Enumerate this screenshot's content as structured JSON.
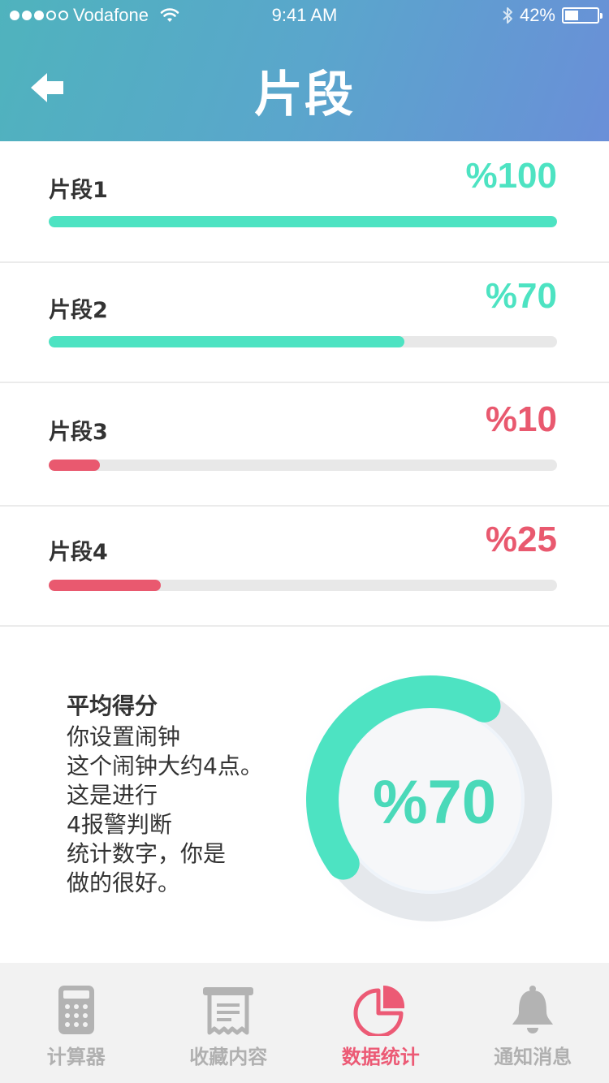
{
  "status_bar": {
    "carrier": "Vodafone",
    "time": "9:41 AM",
    "battery": "42%",
    "battery_level": 0.42,
    "signal_bars": 3
  },
  "header": {
    "title": "片段"
  },
  "segments": [
    {
      "label": "片段1",
      "value": "%100",
      "percent": 100,
      "color": "#4de3c2"
    },
    {
      "label": "片段2",
      "value": "%70",
      "percent": 70,
      "color": "#4de3c2"
    },
    {
      "label": "片段3",
      "value": "%10",
      "percent": 10,
      "color": "#e9596f"
    },
    {
      "label": "片段4",
      "value": "%25",
      "percent": 22,
      "color": "#e9596f"
    }
  ],
  "average": {
    "title": "平均得分",
    "lines": [
      "你设置闹钟",
      "这个闹钟大约4点。",
      "这是进行",
      "4报警判断",
      "统计数字，你是",
      "做的很好。"
    ],
    "value": "%70",
    "percent": 70,
    "color": "#4de3c2"
  },
  "tabbar": {
    "items": [
      {
        "label": "计算器",
        "icon": "calculator-icon"
      },
      {
        "label": "收藏内容",
        "icon": "receipt-icon"
      },
      {
        "label": "数据统计",
        "icon": "pie-chart-icon",
        "active": true
      },
      {
        "label": "通知消息",
        "icon": "bell-icon"
      }
    ],
    "active_color": "#ec5a75",
    "inactive_color": "#b0b0b0"
  }
}
